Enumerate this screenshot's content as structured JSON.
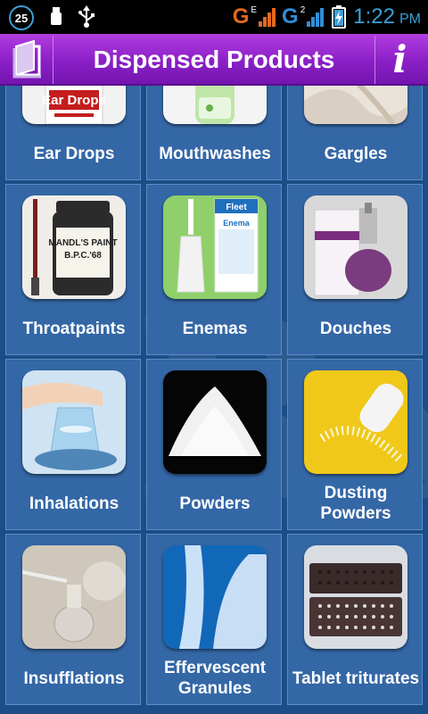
{
  "status_bar": {
    "notification_count": "25",
    "network_type_1": "G",
    "network_sub_1": "E",
    "network_type_2": "G",
    "network_sub_2": "2",
    "time": "1:22",
    "ampm": "PM",
    "icons": [
      "notification-badge-icon",
      "usb-debug-icon",
      "usb-icon",
      "signal-icon",
      "battery-charging-icon"
    ]
  },
  "header": {
    "title": "Dispensed Products",
    "left_icon": "book-icon",
    "right_icon": "info-icon"
  },
  "watermark": "Rx",
  "products": [
    {
      "label": "Ear Drops"
    },
    {
      "label": "Mouthwashes"
    },
    {
      "label": "Gargles"
    },
    {
      "label": "Throatpaints",
      "image_text": "MANDL'S PAINT B.P.C.'68"
    },
    {
      "label": "Enemas",
      "image_text": "Fleet Enema"
    },
    {
      "label": "Douches"
    },
    {
      "label": "Inhalations"
    },
    {
      "label": "Powders"
    },
    {
      "label": "Dusting Powders"
    },
    {
      "label": "Insufflations"
    },
    {
      "label": "Effervescent Granules"
    },
    {
      "label": "Tablet triturates"
    }
  ],
  "ear_drops_image_text": "Ear Drops",
  "colors": {
    "header_purple": "#8a1fc6",
    "tile_blue": "#3467a6",
    "background_blue": "#1b4e86",
    "clock_blue": "#3aa0d8"
  }
}
